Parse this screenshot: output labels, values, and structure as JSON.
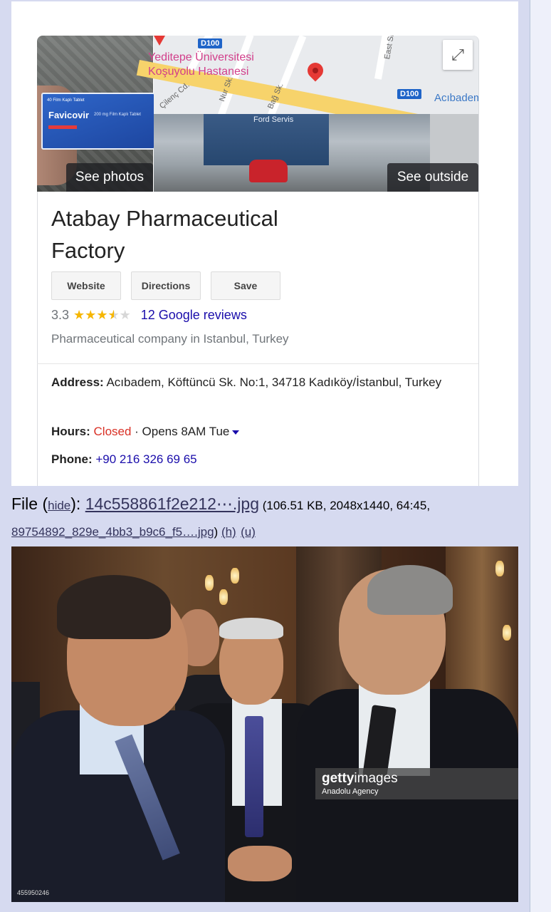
{
  "card": {
    "map_labels": {
      "line1": "Yeditepe Üniversitesi",
      "line2": "Koşuyolu Hastanesi",
      "road_shield_1": "D100",
      "road_shield_2": "D100",
      "district": "Acıbadem",
      "street_1": "Çilenç Cd.",
      "street_2": "Nur Sk.",
      "street_3": "Bağ Sk.",
      "street_4": "East Sk."
    },
    "photo_box": {
      "brand": "Favicovir",
      "top": "40 Film Kaplı Tablet",
      "sub": "200 mg Film Kaplı Tablet"
    },
    "building_sign": "Ford Servis",
    "see_photos": "See photos",
    "see_outside": "See outside",
    "title": "Atabay Pharmaceutical Factory",
    "buttons": [
      "Website",
      "Directions",
      "Save"
    ],
    "rating": "3.3",
    "rating_value": 3.3,
    "reviews": "12 Google reviews",
    "category": "Pharmaceutical company in Istanbul, Turkey",
    "address_label": "Address:",
    "address": " Acıbadem, Köftüncü Sk. No:1, 34718 Kadıköy/İstanbul, Turkey",
    "hours_label": "Hours:",
    "hours_status": "Closed",
    "hours_rest": " · Opens 8AM Tue",
    "phone_label": "Phone:",
    "phone": "+90 216 326 69 65"
  },
  "file": {
    "prefix": "File (",
    "hide": "hide",
    "after_hide": "): ",
    "filename": "14c558861f2e212⋯.jpg",
    "meta": " (106.51 KB, 2048x1440, 64:45, ",
    "original_name": "89754892_829e_4bb3_b9c6_f5….jpg",
    "close": ") ",
    "h": "(h)",
    "u": "(u)"
  },
  "photo": {
    "getty_logo_bold": "getty",
    "getty_logo_light": "images",
    "agency": "Anadolu Agency",
    "photo_id": "455950246"
  }
}
